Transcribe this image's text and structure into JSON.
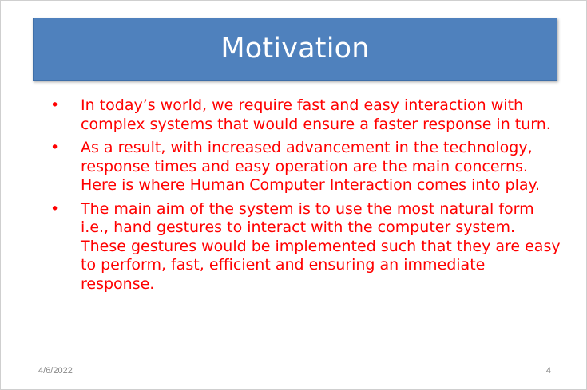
{
  "slide": {
    "title": "Motivation",
    "bullets": [
      "In today’s world, we require fast and easy interaction with complex systems that would ensure a faster response in turn.",
      "As a result, with increased advancement in the technology, response times and easy operation are the main concerns. Here is where Human Computer Interaction comes into play.",
      "The main aim of the system is to use the most natural form i.e., hand gestures to interact with the computer system. These gestures would be implemented such that they are easy to perform, fast, efficient and ensuring an immediate response."
    ],
    "bullet_glyph": "•",
    "footer": {
      "date": "4/6/2022",
      "page_number": "4"
    }
  },
  "colors": {
    "title_bar": "#4f81bd",
    "title_text": "#ffffff",
    "body_text": "#ff0000",
    "footer_text": "#8a8a8a"
  }
}
